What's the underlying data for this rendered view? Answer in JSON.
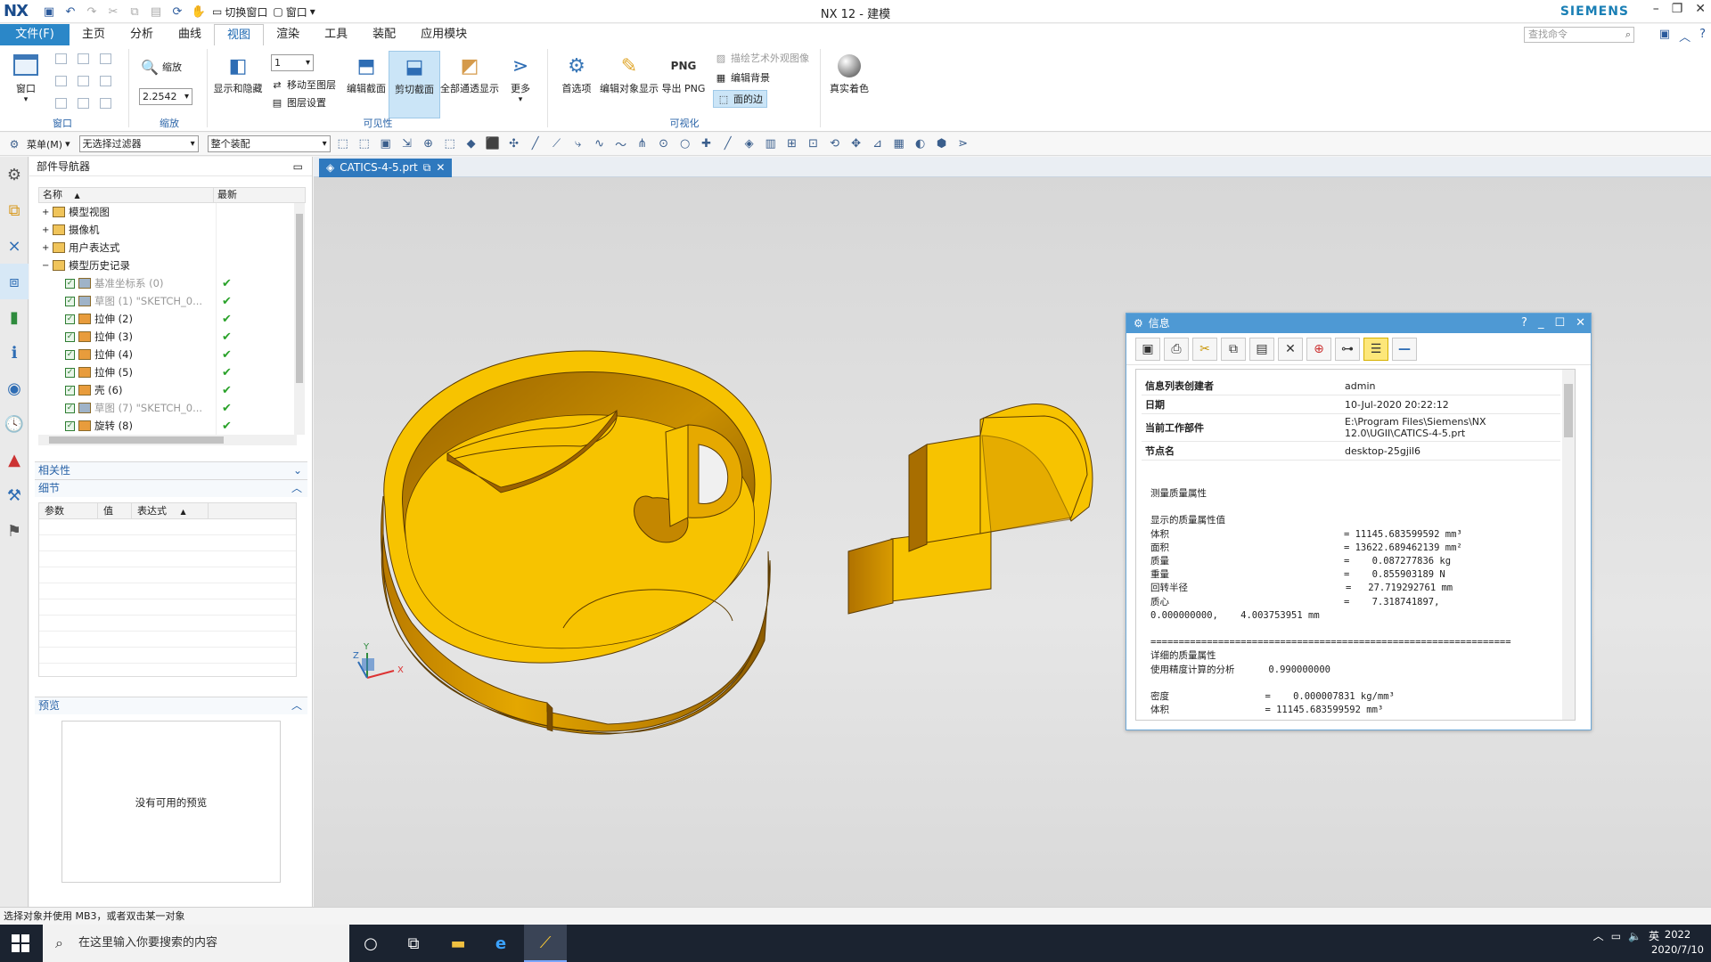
{
  "titlebar": {
    "logo": "NX",
    "title": "NX 12 - 建模",
    "brand": "SIEMENS",
    "switch_window": "切换窗口",
    "window": "窗口"
  },
  "tabs": {
    "file": "文件(F)",
    "items": [
      "主页",
      "分析",
      "曲线",
      "视图",
      "渲染",
      "工具",
      "装配",
      "应用模块"
    ],
    "active": "视图",
    "search_placeholder": "查找命令"
  },
  "ribbon": {
    "window_btn": "窗口",
    "window_group": "窗口",
    "zoom_label": "缩放",
    "zoom_value": "2.2542",
    "zoom_group": "缩放",
    "layer_value": "1",
    "show_hide": "显示和隐藏",
    "move_to_layer": "移动至图层",
    "layer_settings": "图层设置",
    "edit_section": "编辑截面",
    "clip_section": "剪切截面",
    "all_pass_display": "全部通透显示",
    "more": "更多",
    "visibility_group": "可见性",
    "preferences": "首选项",
    "edit_object_display": "编辑对象显示",
    "export_png": "导出 PNG",
    "png_icon_text": "PNG",
    "artistic_appearance": "描绘艺术外观图像",
    "edit_background": "编辑背景",
    "face_edges": "面的边",
    "visualization_group": "可视化",
    "true_shading": "真实着色"
  },
  "toolbar": {
    "menu": "菜单(M)",
    "filter": "无选择过滤器",
    "assembly": "整个装配"
  },
  "navigator": {
    "title": "部件导航器",
    "col_name": "名称",
    "col_latest": "最新",
    "rows": [
      {
        "label": "模型视图",
        "check": false,
        "dim": false
      },
      {
        "label": "摄像机",
        "check": false,
        "dim": false
      },
      {
        "label": "用户表达式",
        "check": false,
        "dim": false
      },
      {
        "label": "模型历史记录",
        "check": false,
        "dim": false
      },
      {
        "label": "基准坐标系 (0)",
        "check": true,
        "dim": true
      },
      {
        "label": "草图 (1) \"SKETCH_0...",
        "check": true,
        "dim": true
      },
      {
        "label": "拉伸 (2)",
        "check": true,
        "dim": false
      },
      {
        "label": "拉伸 (3)",
        "check": true,
        "dim": false
      },
      {
        "label": "拉伸 (4)",
        "check": true,
        "dim": false
      },
      {
        "label": "拉伸 (5)",
        "check": true,
        "dim": false
      },
      {
        "label": "壳 (6)",
        "check": true,
        "dim": false
      },
      {
        "label": "草图 (7) \"SKETCH_0...",
        "check": true,
        "dim": true
      },
      {
        "label": "旋转 (8)",
        "check": true,
        "dim": false
      }
    ],
    "dependencies": "相关性",
    "details": "细节",
    "detail_cols": [
      "参数",
      "值",
      "表达式"
    ],
    "preview": "预览",
    "no_preview": "没有可用的预览"
  },
  "graphics": {
    "tab_label": "CATICS-4-5.prt",
    "body_color": "#f7c300"
  },
  "info": {
    "title": "信息",
    "kv": [
      {
        "k": "信息列表创建者",
        "v": "admin"
      },
      {
        "k": "日期",
        "v": "10-Jul-2020 20:22:12"
      },
      {
        "k": "当前工作部件",
        "v": "E:\\Program Files\\Siemens\\NX 12.0\\UGII\\CATICS-4-5.prt"
      },
      {
        "k": "节点名",
        "v": "desktop-25gjil6"
      }
    ],
    "text": "测量质量属性\n\n显示的质量属性值\n体积                               = 11145.683599592 mm³\n面积                               = 13622.689462139 mm²\n质量                               =    0.087277836 kg\n重量                               =    0.855903189 N\n回转半径                            =   27.719292761 mm\n质心                               =    7.318741897,\n0.000000000,    4.003753951 mm\n\n================================================================\n详细的质量属性\n使用精度计算的分析      0.990000000\n\n密度                 =    0.000007831 kg/mm³\n体积                 = 11145.683599592 mm³"
  },
  "status": {
    "message": "选择对象并使用 MB3，或者双击某一对象"
  },
  "taskbar": {
    "search_placeholder": "在这里输入你要搜索的内容",
    "ime": "英",
    "time": "2022",
    "date": "2020/7/10"
  }
}
